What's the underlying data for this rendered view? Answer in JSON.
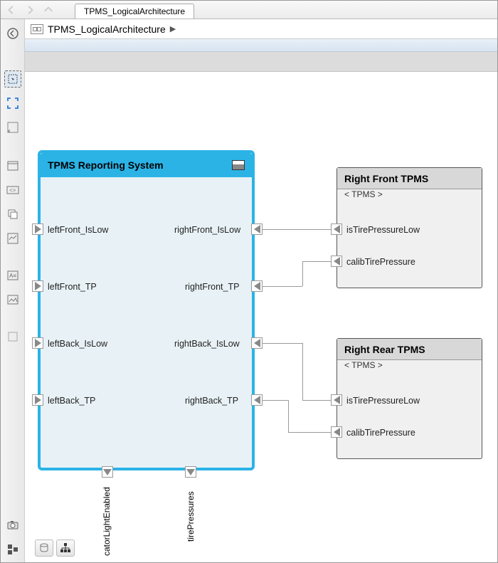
{
  "tab": {
    "title": "TPMS_LogicalArchitecture"
  },
  "breadcrumb": {
    "title": "TPMS_LogicalArchitecture"
  },
  "blocks": {
    "reporting": {
      "title": "TPMS Reporting System",
      "ports_left": [
        "leftFront_IsLow",
        "leftFront_TP",
        "leftBack_IsLow",
        "leftBack_TP"
      ],
      "ports_right": [
        "rightFront_IsLow",
        "rightFront_TP",
        "rightBack_IsLow",
        "rightBack_TP"
      ],
      "ports_bottom": [
        "catorLightEnabled",
        "tirePressures"
      ]
    },
    "rightFront": {
      "title": "Right Front TPMS",
      "stereotype": "< TPMS >",
      "ports": [
        "isTirePressureLow",
        "calibTirePressure"
      ]
    },
    "rightRear": {
      "title": "Right Rear TPMS",
      "stereotype": "< TPMS >",
      "ports": [
        "isTirePressureLow",
        "calibTirePressure"
      ]
    }
  }
}
